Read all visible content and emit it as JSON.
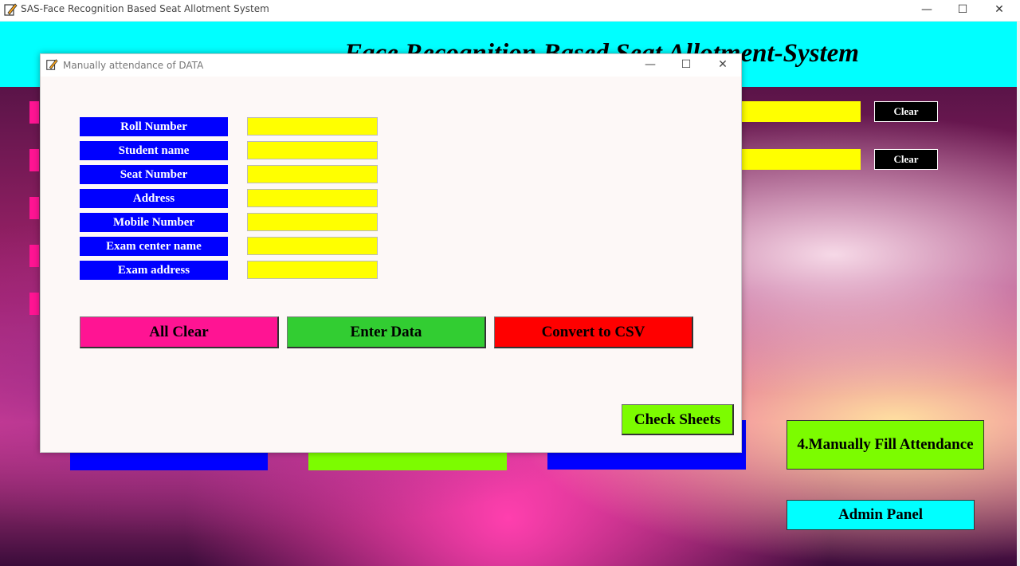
{
  "window": {
    "title": "SAS-Face Recognition Based Seat Allotment System",
    "minimize": "—",
    "maximize": "☐",
    "close": "✕"
  },
  "banner": {
    "title": "Face Recognition Based Seat Allotment-System"
  },
  "main": {
    "clear_buttons": [
      "Clear",
      "Clear"
    ],
    "manual_fill_button": "4.Manually Fill Attendance",
    "admin_panel_button": "Admin Panel",
    "colors": {
      "banner": "#00ffff",
      "field": "#ffff00",
      "manual_fill": "#7cfc00",
      "admin": "#00ffff",
      "stub_blue": "#0000ff"
    }
  },
  "dialog": {
    "title": "Manually attendance of DATA",
    "minimize": "—",
    "maximize": "☐",
    "close": "✕",
    "fields": [
      {
        "label": "Roll Number",
        "value": ""
      },
      {
        "label": "Student name",
        "value": ""
      },
      {
        "label": "Seat Number",
        "value": ""
      },
      {
        "label": "Address",
        "value": ""
      },
      {
        "label": "Mobile Number",
        "value": ""
      },
      {
        "label": "Exam center name",
        "value": ""
      },
      {
        "label": "Exam address",
        "value": ""
      }
    ],
    "buttons": {
      "all_clear": "All Clear",
      "enter_data": "Enter Data",
      "convert_csv": "Convert to CSV",
      "check_sheets": "Check Sheets"
    },
    "colors": {
      "label_bg": "#0000ff",
      "all_clear": "#ff1493",
      "enter_data": "#32cd32",
      "convert_csv": "#ff0000",
      "check_sheets": "#7cfc00"
    }
  }
}
